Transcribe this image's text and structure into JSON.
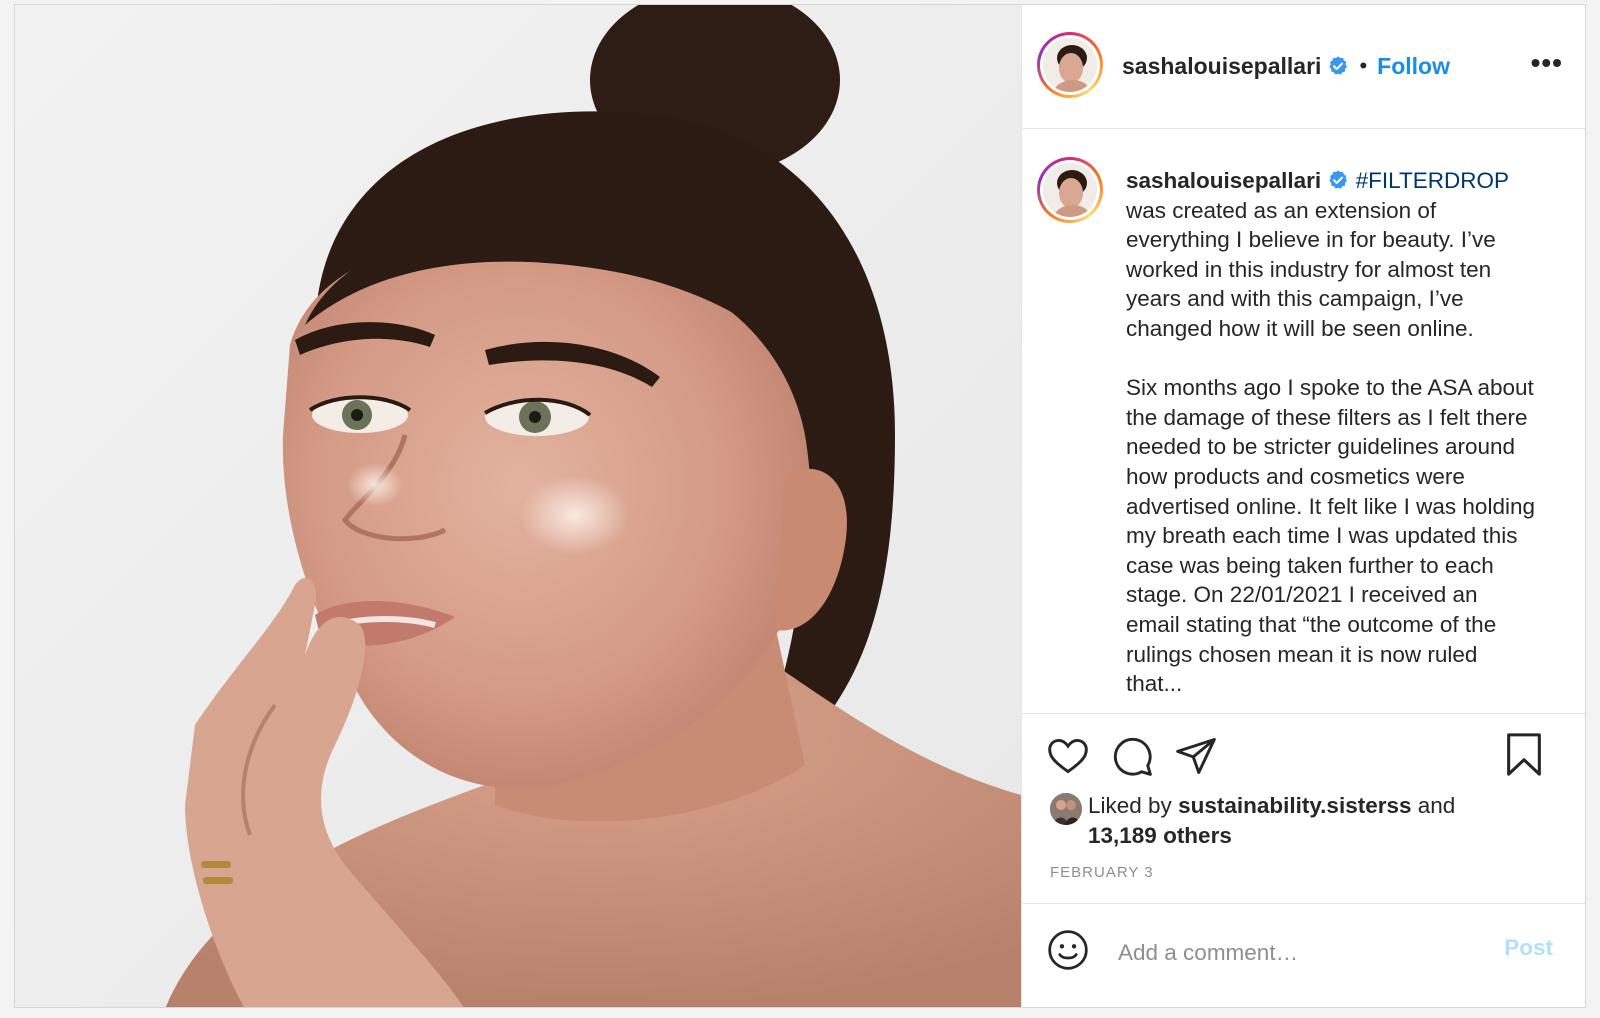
{
  "post": {
    "photo_alt": "",
    "author": {
      "username": "sashalouisepallari",
      "verified_icon": "verified-badge-icon",
      "follow_label": "Follow",
      "more_icon": "more-options-icon"
    },
    "caption": {
      "username": "sashalouisepallari",
      "hashtag": "#FILTERDROP",
      "text": "was created as an extension of everything I believe in for beauty. I’ve worked in this industry for almost ten years and with this campaign, I’ve changed how it will be seen online.\n\nSix months ago I spoke to the ASA about the damage of these filters as I felt there needed to be stricter guidelines around how products and cosmetics were advertised online. It felt like I was holding my breath each time I was updated this case was being taken further to each stage. On 22/01/2021 I received an email stating that “the outcome of the rulings chosen mean it is now ruled that..."
    },
    "actions": {
      "like_icon": "heart-icon",
      "comment_icon": "comment-icon",
      "share_icon": "share-icon",
      "save_icon": "bookmark-icon"
    },
    "likes": {
      "prefix": "Liked by ",
      "user": "sustainability.sisterss",
      "middle": " and",
      "count": "13,189 others"
    },
    "date": "FEBRUARY 3",
    "comment": {
      "emoji_icon": "emoji-icon",
      "placeholder": "Add a comment…",
      "post_label": "Post"
    }
  },
  "colors": {
    "link_blue": "#1c8ce8",
    "hashtag": "#00376b",
    "post_disabled": "#b2dffc",
    "muted": "#8e8e8e"
  }
}
